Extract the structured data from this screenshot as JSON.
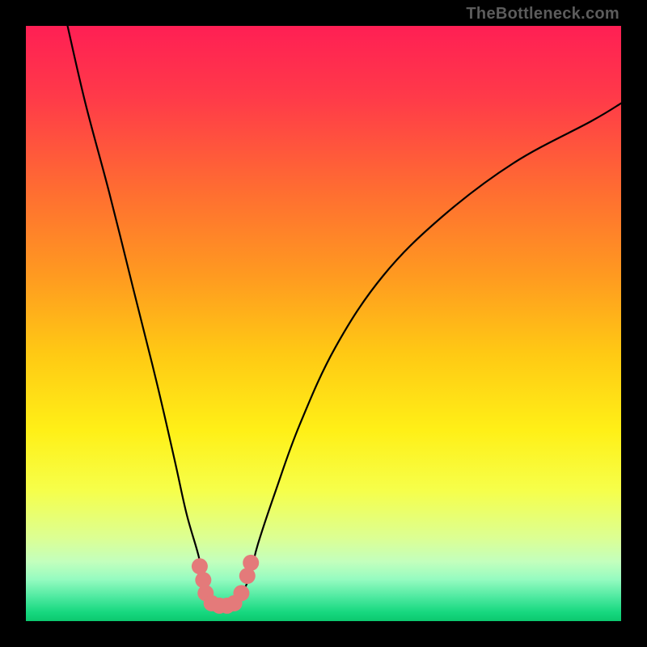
{
  "watermark": "TheBottleneck.com",
  "gradient_stops": [
    {
      "offset": 0.0,
      "color": "#ff1f54"
    },
    {
      "offset": 0.12,
      "color": "#ff3a49"
    },
    {
      "offset": 0.28,
      "color": "#ff6e31"
    },
    {
      "offset": 0.42,
      "color": "#ff9a20"
    },
    {
      "offset": 0.55,
      "color": "#ffc914"
    },
    {
      "offset": 0.68,
      "color": "#fff017"
    },
    {
      "offset": 0.78,
      "color": "#f6ff4a"
    },
    {
      "offset": 0.86,
      "color": "#dcff93"
    },
    {
      "offset": 0.9,
      "color": "#c3ffbd"
    },
    {
      "offset": 0.93,
      "color": "#95fbc0"
    },
    {
      "offset": 0.96,
      "color": "#4de9a0"
    },
    {
      "offset": 0.985,
      "color": "#17d87f"
    },
    {
      "offset": 1.0,
      "color": "#0cc86f"
    }
  ],
  "chart_data": {
    "type": "line",
    "title": "",
    "xlabel": "",
    "ylabel": "",
    "xlim": [
      0,
      100
    ],
    "ylim": [
      0,
      100
    ],
    "series": [
      {
        "name": "bottleneck-curve",
        "x": [
          7,
          10,
          14,
          18,
          22,
          25,
          27,
          29,
          30,
          31,
          32.5,
          34,
          35.5,
          37,
          38,
          39,
          42,
          46,
          52,
          60,
          70,
          82,
          95,
          100
        ],
        "y": [
          100,
          87,
          72,
          56,
          40,
          27,
          18,
          11,
          6,
          3.5,
          2.6,
          2.6,
          3.5,
          6,
          9,
          13,
          22,
          33,
          46,
          58,
          68,
          77,
          84,
          87
        ]
      }
    ],
    "markers": [
      {
        "name": "marker-L1",
        "x": 29.2,
        "y": 9.2
      },
      {
        "name": "marker-L2",
        "x": 29.8,
        "y": 6.9
      },
      {
        "name": "marker-L3",
        "x": 30.2,
        "y": 4.7
      },
      {
        "name": "marker-B1",
        "x": 31.2,
        "y": 3.0
      },
      {
        "name": "marker-B2",
        "x": 32.5,
        "y": 2.6
      },
      {
        "name": "marker-B3",
        "x": 33.8,
        "y": 2.6
      },
      {
        "name": "marker-B4",
        "x": 35.0,
        "y": 3.0
      },
      {
        "name": "marker-R3",
        "x": 36.2,
        "y": 4.7
      },
      {
        "name": "marker-R2",
        "x": 37.2,
        "y": 7.6
      },
      {
        "name": "marker-R1",
        "x": 37.8,
        "y": 9.8
      }
    ],
    "marker_color": "#e47a7a",
    "marker_radius": 10,
    "curve_stroke": "#000000",
    "curve_width": 2.2
  }
}
